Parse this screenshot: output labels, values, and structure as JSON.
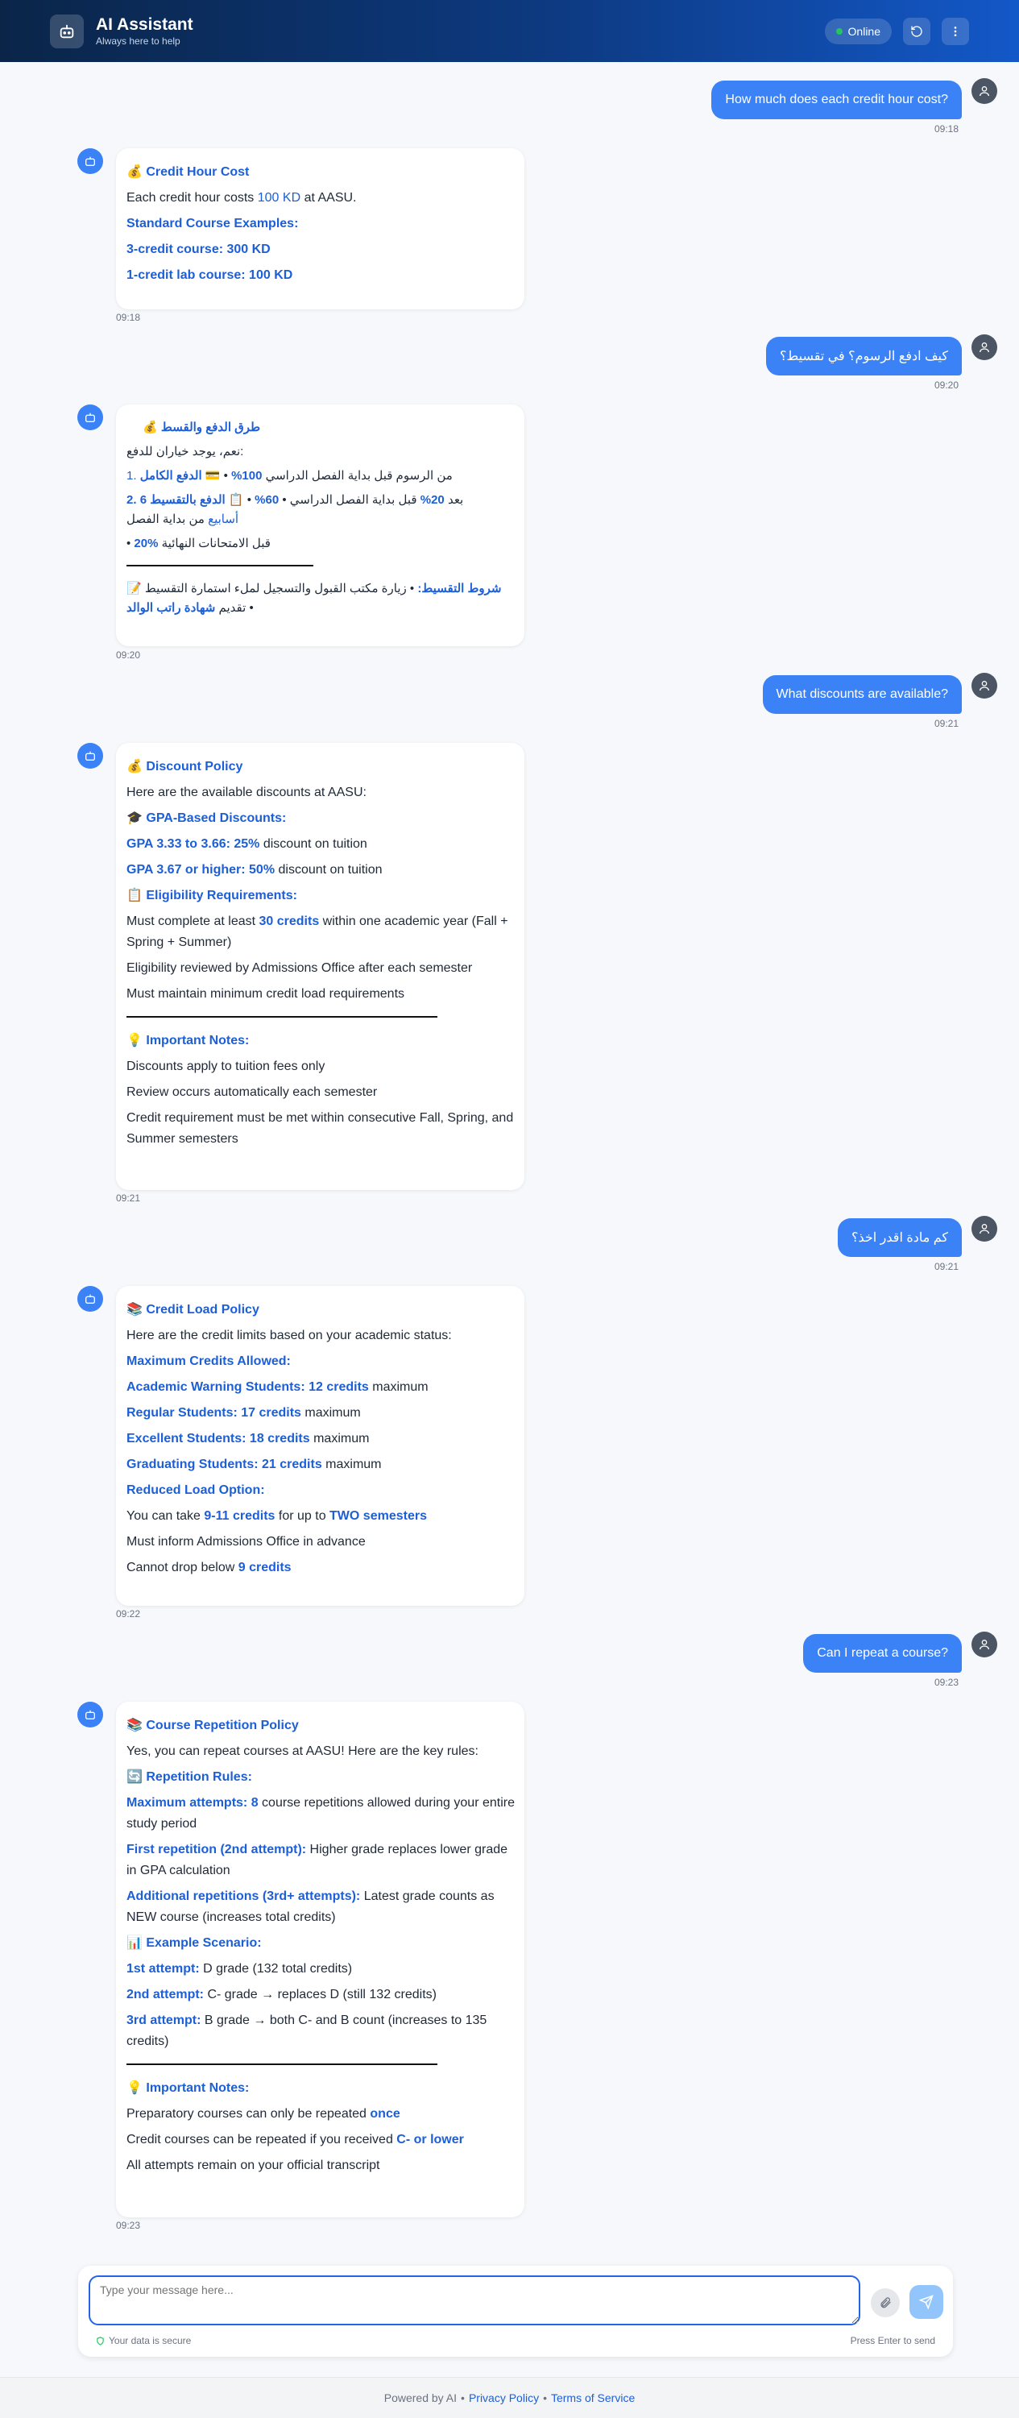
{
  "header": {
    "title": "AI Assistant",
    "subtitle": "Always here to help",
    "status": "Online",
    "logo_icon": "robot-icon",
    "refresh_icon": "refresh-icon",
    "menu_icon": "more-vertical-icon"
  },
  "colors": {
    "accent": "#3b82f6",
    "highlight": "#1d5fd6",
    "header_start": "#0a2548",
    "header_end": "#1358c8",
    "online": "#22c55e"
  },
  "messages": {
    "u1": {
      "text": "How much does each credit hour cost?",
      "time": "09:18"
    },
    "b1": {
      "time": "09:18",
      "title": "💰 Credit Hour Cost",
      "l1a": "Each credit hour costs ",
      "l1b": "100 KD",
      "l1c": " at AASU.",
      "h2": "Standard Course Examples:",
      "e1": "3-credit course: 300 KD",
      "e2": "1-credit lab course: 100 KD"
    },
    "u2": {
      "text": "كيف ادفع الرسوم؟ في تقسيط؟",
      "time": "09:20"
    },
    "b2": {
      "time": "09:20",
      "title": "💰 طرق الدفع والقسط",
      "intro": "نعم، يوجد خياران للدفع:",
      "p1a": "1. ",
      "p1b": "💳 ",
      "p1c": "الدفع الكامل",
      "p1d": " • ",
      "p1e": "100%",
      "p1f": " من الرسوم قبل بداية الفصل الدراسي",
      "p2a": "2. ",
      "p2b": "📋 ",
      "p2c": "الدفع بالتقسيط",
      "p2d": " • ",
      "p2e": "60%",
      "p2f": " قبل بداية الفصل الدراسي • ",
      "p2g": "20%",
      "p2h": " بعد ",
      "p2i": "6",
      "p2j": " ",
      "p2k": "أسابيع",
      "p2l": " من بداية الفصل",
      "p3a": "• ",
      "p3b": "20%",
      "p3c": " قبل الامتحانات النهائية",
      "c1": "📝 ",
      "c2": "شروط التقسيط:",
      "c3": " • زيارة مكتب القبول والتسجيل لملء استمارة التقسيط • تقديم ",
      "c4": "شهادة راتب الوالد"
    },
    "u3": {
      "text": "What discounts are available?",
      "time": "09:21"
    },
    "b3": {
      "time": "09:21",
      "title": "💰 Discount Policy",
      "intro": "Here are the available discounts at AASU:",
      "h2": "🎓 GPA-Based Discounts:",
      "g1a": "GPA 3.33 to 3.66: 25%",
      "g1b": " discount on tuition",
      "g2a": "GPA 3.67 or higher: 50%",
      "g2b": " discount on tuition",
      "h3": "📋 Eligibility Requirements:",
      "r1a": "Must complete at least ",
      "r1b": "30 credits",
      "r1c": " within one academic year (Fall + Spring + Summer)",
      "r2": "Eligibility reviewed by Admissions Office after each semester",
      "r3": "Must maintain minimum credit load requirements",
      "h4": "💡 Important Notes:",
      "n1": "Discounts apply to tuition fees only",
      "n2": "Review occurs automatically each semester",
      "n3": "Credit requirement must be met within consecutive Fall, Spring, and Summer semesters"
    },
    "u4": {
      "text": "كم مادة اقدر اخذ؟",
      "time": "09:21"
    },
    "b4": {
      "time": "09:22",
      "title": "📚 Credit Load Policy",
      "intro": "Here are the credit limits based on your academic status:",
      "h2": "Maximum Credits Allowed:",
      "m1a": "Academic Warning Students: 12 credits",
      "m1b": " maximum",
      "m2a": "Regular Students: 17 credits",
      "m2b": " maximum",
      "m3a": "Excellent Students: 18 credits",
      "m3b": " maximum",
      "m4a": "Graduating Students: 21 credits",
      "m4b": " maximum",
      "h3": "Reduced Load Option:",
      "o1a": "You can take ",
      "o1b": "9-11 credits",
      "o1c": " for up to ",
      "o1d": "TWO semesters",
      "o2": "Must inform Admissions Office in advance",
      "o3a": "Cannot drop below ",
      "o3b": "9 credits"
    },
    "u5": {
      "text": "Can I repeat a course?",
      "time": "09:23"
    },
    "b5": {
      "time": "09:23",
      "title": "📚 Course Repetition Policy",
      "intro": "Yes, you can repeat courses at AASU! Here are the key rules:",
      "h2": "🔄 Repetition Rules:",
      "r1a": "Maximum attempts: 8",
      "r1b": " course repetitions allowed during your entire study period",
      "r2a": "First repetition (2nd attempt):",
      "r2b": " Higher grade replaces lower grade in GPA calculation",
      "r3a": "Additional repetitions (3rd+ attempts):",
      "r3b": " Latest grade counts as NEW course (increases total credits)",
      "h3": "📊 Example Scenario:",
      "s1a": "1st attempt:",
      "s1b": " D grade (132 total credits)",
      "s2a": "2nd attempt:",
      "s2b": " C- grade → replaces D (still 132 credits)",
      "s3a": "3rd attempt:",
      "s3b": " B grade → both C- and B count (increases to 135 credits)",
      "h4": "💡 Important Notes:",
      "n1a": "Preparatory courses can only be repeated ",
      "n1b": "once",
      "n2a": "Credit courses can be repeated if you received ",
      "n2b": "C- or lower",
      "n3": "All attempts remain on your official transcript"
    }
  },
  "composer": {
    "placeholder": "Type your message here...",
    "secure": "Your data is secure",
    "hint": "Press Enter to send",
    "attach_icon": "paperclip-icon",
    "send_icon": "send-icon",
    "shield_icon": "shield-icon"
  },
  "footer": {
    "prefix": "Powered by AI",
    "sep1": "•",
    "privacy": "Privacy Policy",
    "sep2": "•",
    "terms": "Terms of Service"
  }
}
